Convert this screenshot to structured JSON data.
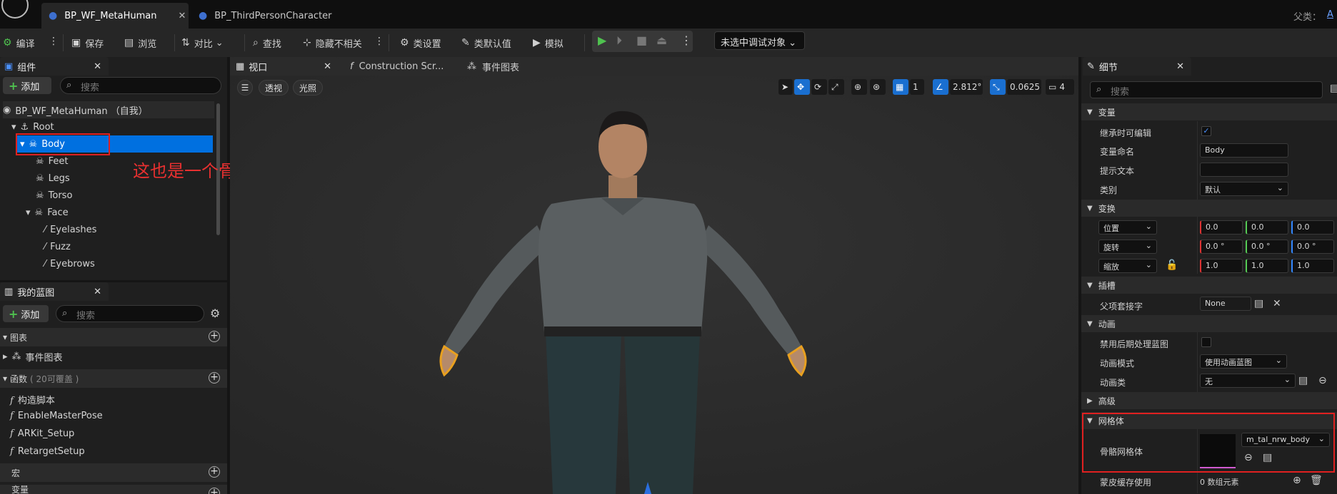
{
  "tabs": [
    {
      "label": "BP_WF_MetaHuman",
      "active": true
    },
    {
      "label": "BP_ThirdPersonCharacter",
      "active": false
    }
  ],
  "parent_label": "父类：",
  "parent_value": "A",
  "toolbar": {
    "compile": "编译",
    "save": "保存",
    "browse": "浏览",
    "diff": "对比",
    "find": "查找",
    "hide_unrelated": "隐藏不相关",
    "class_settings": "类设置",
    "class_defaults": "类默认值",
    "simulate": "模拟",
    "debug_object": "未选中调试对象"
  },
  "components": {
    "tab": "组件",
    "add": "添加",
    "search_placeholder": "搜索",
    "root_item": "BP_WF_MetaHuman （自我）",
    "items": [
      "Root",
      "Body",
      "Feet",
      "Legs",
      "Torso",
      "Face",
      "Eyelashes",
      "Fuzz",
      "Eyebrows"
    ]
  },
  "annotation": "这也是一个骨架网格体，只不过是换了名字",
  "my_blueprint": {
    "tab": "我的蓝图",
    "add": "添加",
    "search_placeholder": "搜索",
    "graphs": "图表",
    "event_graph": "事件图表",
    "functions": "函数",
    "functions_count": "( 20可覆盖 )",
    "function_items": [
      "构造脚本",
      "EnableMasterPose",
      "ARKit_Setup",
      "RetargetSetup"
    ],
    "macros": "宏",
    "variables": "变量"
  },
  "viewport": {
    "tabs": [
      "视口",
      "Construction Scr...",
      "事件图表"
    ],
    "perspective": "透视",
    "lit": "光照",
    "grid_value": "1",
    "angle_value": "2.812°",
    "scale_value": "0.0625",
    "camera_speed": "4"
  },
  "details": {
    "tab": "细节",
    "search_placeholder": "搜索",
    "sections": {
      "variable": "变量",
      "transform": "变换",
      "sockets": "插槽",
      "animation": "动画",
      "advanced": "高级",
      "mesh": "网格体"
    },
    "labels": {
      "instance_editable": "继承时可编辑",
      "variable_name": "变量命名",
      "tooltip": "提示文本",
      "category": "类别",
      "parent_socket": "父项套接字",
      "disable_post_process": "禁用后期处理蓝图",
      "animation_mode": "动画模式",
      "anim_class": "动画类",
      "skeletal_mesh": "骨骼网格体",
      "skin_cache": "蒙皮缓存使用"
    },
    "values": {
      "variable_name": "Body",
      "tooltip": "",
      "category": "默认",
      "location_mode": "位置",
      "rotation_mode": "旋转",
      "scale_mode": "缩放",
      "location": [
        "0.0",
        "0.0",
        "0.0"
      ],
      "rotation": [
        "0.0 °",
        "0.0 °",
        "0.0 °"
      ],
      "scale": [
        "1.0",
        "1.0",
        "1.0"
      ],
      "parent_socket": "None",
      "animation_mode": "使用动画蓝图",
      "anim_class": "无",
      "skeletal_mesh": "m_tal_nrw_body",
      "skin_cache": "0 数组元素"
    }
  }
}
